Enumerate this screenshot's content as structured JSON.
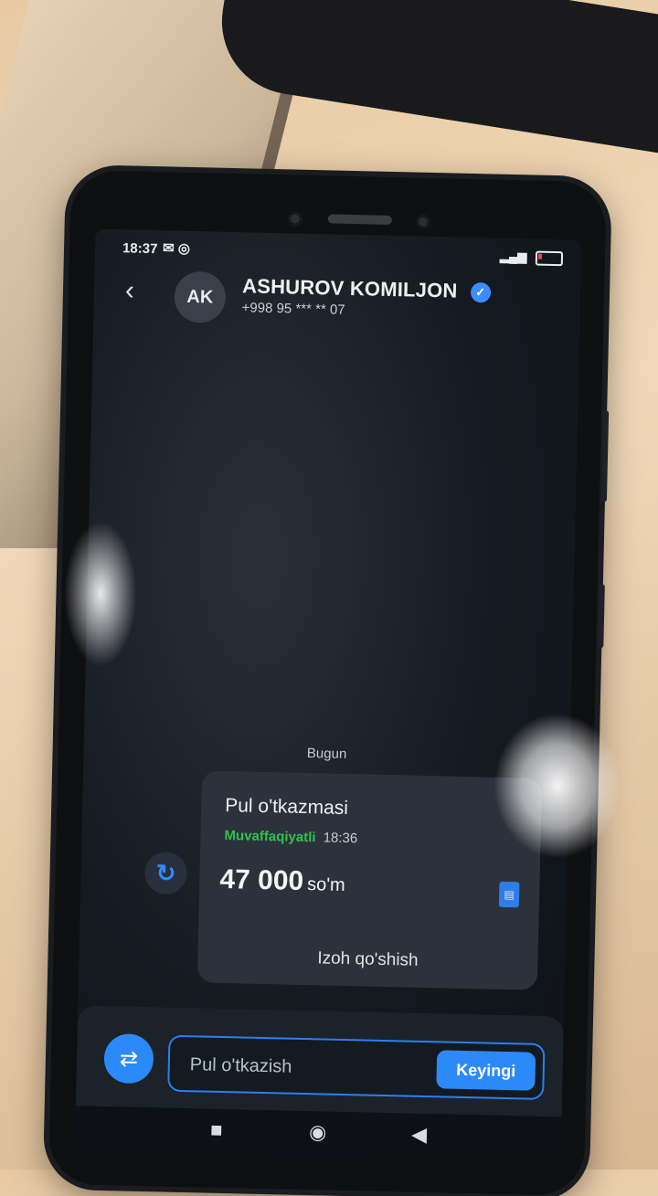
{
  "status_bar": {
    "time": "18:37",
    "icons": "✉ ◎",
    "signal": "▂▄▆",
    "battery_label": "13"
  },
  "header": {
    "back_glyph": "‹",
    "avatar_initials": "AK",
    "contact_name": "ASHUROV KOMILJON",
    "verified_glyph": "✓",
    "contact_phone": "+998 95 *** ** 07"
  },
  "chat": {
    "date_separator": "Bugun",
    "repeat_glyph": "↻",
    "transfer": {
      "title": "Pul o'tkazmasi",
      "status": "Muvaffaqiyatli",
      "time": "18:36",
      "amount": "47 000",
      "currency": "so'm",
      "receipt_glyph": "▤",
      "comment_action": "Izoh qo'shish"
    }
  },
  "input_bar": {
    "transfer_glyph": "⇄",
    "placeholder": "Pul o'tkazish",
    "next_label": "Keyingi"
  },
  "navbar": {
    "recent": "■",
    "home": "◉",
    "back": "◀"
  },
  "colors": {
    "accent": "#2b8af7",
    "success": "#2ec24b",
    "card_bg": "#2c323b"
  }
}
